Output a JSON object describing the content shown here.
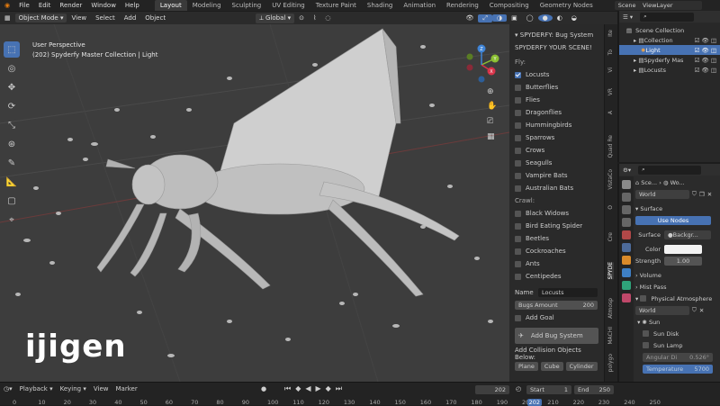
{
  "topbar": {
    "menus": [
      "File",
      "Edit",
      "Render",
      "Window",
      "Help"
    ],
    "workspaces": [
      "Layout",
      "Modeling",
      "Sculpting",
      "UV Editing",
      "Texture Paint",
      "Shading",
      "Animation",
      "Rendering",
      "Compositing",
      "Geometry Nodes"
    ],
    "scene": "Scene",
    "view_layer": "ViewLayer"
  },
  "header": {
    "mode": "Object Mode",
    "menus": [
      "View",
      "Select",
      "Add",
      "Object"
    ],
    "orientation": "Global",
    "options": "Options"
  },
  "viewport": {
    "perspective": "User Perspective",
    "collection": "(202) Spyderfy Master Collection | Light",
    "axes": {
      "x": "X",
      "y": "Y",
      "z": "Z"
    }
  },
  "logo": "ijigen",
  "npanel": {
    "title": "SPYDERFY: Bug System",
    "subtitle": "SPYDERFY YOUR SCENE!",
    "fly_label": "Fly:",
    "fly": [
      {
        "label": "Locusts",
        "checked": true
      },
      {
        "label": "Butterflies",
        "checked": false
      },
      {
        "label": "Flies",
        "checked": false
      },
      {
        "label": "Dragonflies",
        "checked": false
      },
      {
        "label": "Hummingbirds",
        "checked": false
      },
      {
        "label": "Sparrows",
        "checked": false
      },
      {
        "label": "Crows",
        "checked": false
      },
      {
        "label": "Seagulls",
        "checked": false
      },
      {
        "label": "Vampire Bats",
        "checked": false
      },
      {
        "label": "Australian Bats",
        "checked": false
      }
    ],
    "crawl_label": "Crawl:",
    "crawl": [
      {
        "label": "Black Widows",
        "checked": false
      },
      {
        "label": "Bird Eating Spider",
        "checked": false
      },
      {
        "label": "Beetles",
        "checked": false
      },
      {
        "label": "Cockroaches",
        "checked": false
      },
      {
        "label": "Ants",
        "checked": false
      },
      {
        "label": "Centipedes",
        "checked": false
      }
    ],
    "name_label": "Name",
    "name_value": "Locusts",
    "amount_label": "Bugs Amount",
    "amount_value": "200",
    "add_goal": "Add Goal",
    "add_bug_system": "Add Bug System",
    "collision_label": "Add Collision Objects Below:",
    "collision": [
      "Plane",
      "Cube",
      "Cylinder"
    ]
  },
  "vtabs": [
    "Ite",
    "To",
    "Vi",
    "VR",
    "A",
    "Quad Re",
    "VistaCo",
    "O",
    "Cre",
    "SPYDE",
    "Atmosp",
    "MACHI",
    "polygo"
  ],
  "outliner": {
    "root": "Scene Collection",
    "rows": [
      {
        "label": "Collection",
        "indent": 1
      },
      {
        "label": "Light",
        "indent": 2,
        "selected": true
      },
      {
        "label": "Spyderfy Mas",
        "indent": 1
      },
      {
        "label": "Locusts",
        "indent": 1
      }
    ]
  },
  "properties": {
    "breadcrumb_a": "Sce...",
    "breadcrumb_b": "Wo...",
    "world": "World",
    "surface_panel": "Surface",
    "use_nodes": "Use Nodes",
    "surface_label": "Surface",
    "surface_value": "Backgr...",
    "color_label": "Color",
    "strength_label": "Strength",
    "strength_value": "1.00",
    "volume": "Volume",
    "mist": "Mist Pass",
    "physical_atmosphere": "Physical Atmosphere",
    "world2": "World",
    "sun": "Sun",
    "sun_disk": "Sun Disk",
    "sun_lamp": "Sun Lamp",
    "angular_label": "Angular Di",
    "angular_value": "0.526°",
    "temperature_label": "Temperature",
    "temperature_value": "5700"
  },
  "timeline": {
    "menus": [
      "Playback",
      "Keying",
      "View",
      "Marker"
    ],
    "current": "202",
    "start_label": "Start",
    "start": "1",
    "end_label": "End",
    "end": "250",
    "ticks": [
      "0",
      "10",
      "20",
      "30",
      "40",
      "50",
      "60",
      "70",
      "80",
      "90",
      "100",
      "110",
      "120",
      "130",
      "140",
      "150",
      "160",
      "170",
      "180",
      "190",
      "200",
      "202",
      "210",
      "220",
      "230",
      "240",
      "250"
    ]
  },
  "colors": {
    "accent": "#4772b3",
    "viewport": "#3d3d3d",
    "axis_x": "#d9344a",
    "axis_y": "#8bbf32",
    "axis_z": "#3f84d6",
    "selected": "#4772b3"
  }
}
